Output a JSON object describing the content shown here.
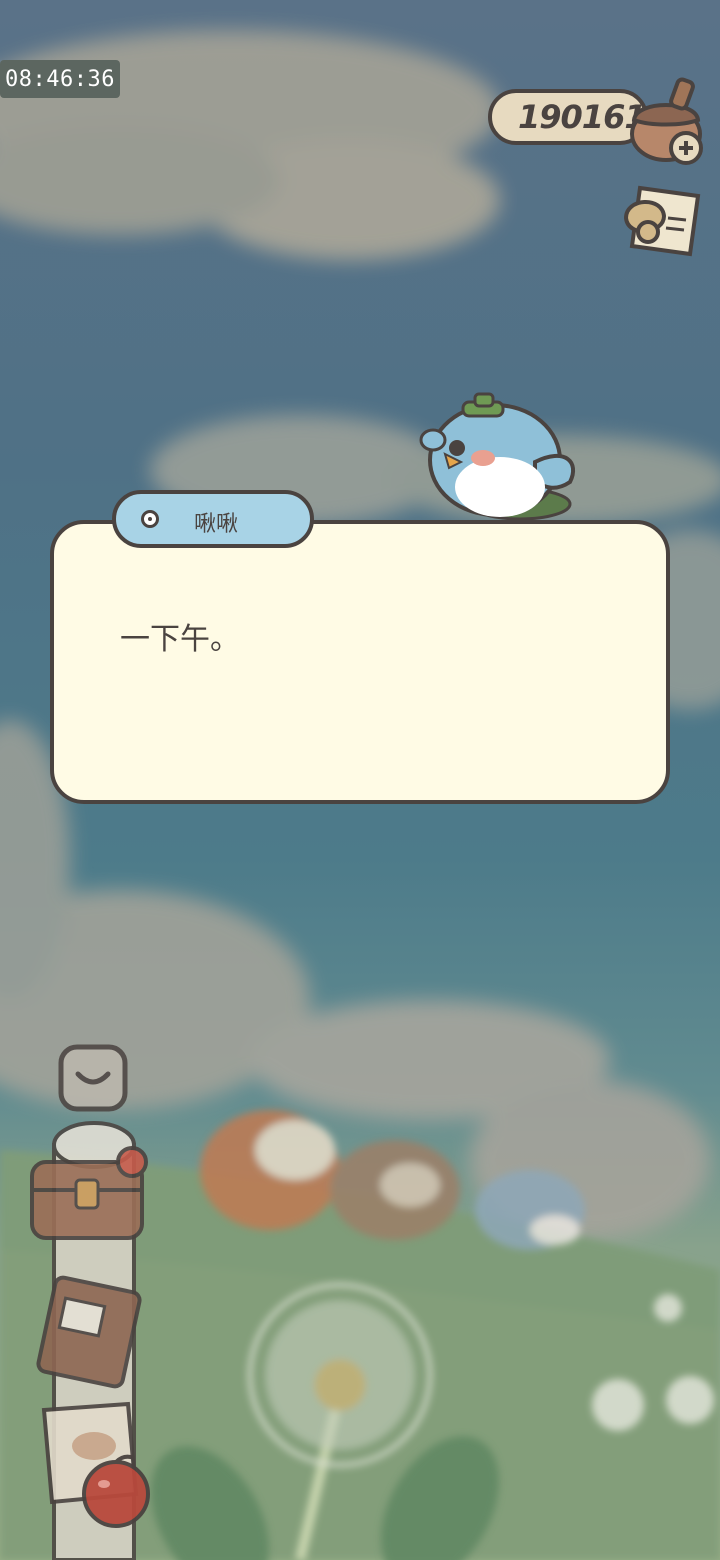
{
  "status": {
    "clock": "08:46:36"
  },
  "hud": {
    "acorn_count": "190161"
  },
  "dialog": {
    "speaker": "啾啾",
    "text": "一下午。"
  },
  "icons": {
    "currency": "acorn-icon",
    "add": "plus-icon",
    "diary": "diary-icon",
    "collapse": "chevron-down-icon",
    "chest": "treasure-chest-icon",
    "journal": "journal-book-icon",
    "map": "map-paper-icon",
    "apple": "apple-icon"
  },
  "colors": {
    "outline": "#4a4340",
    "dialog_bg": "#fffbe5",
    "name_tag_bg": "#a8d3e6"
  }
}
